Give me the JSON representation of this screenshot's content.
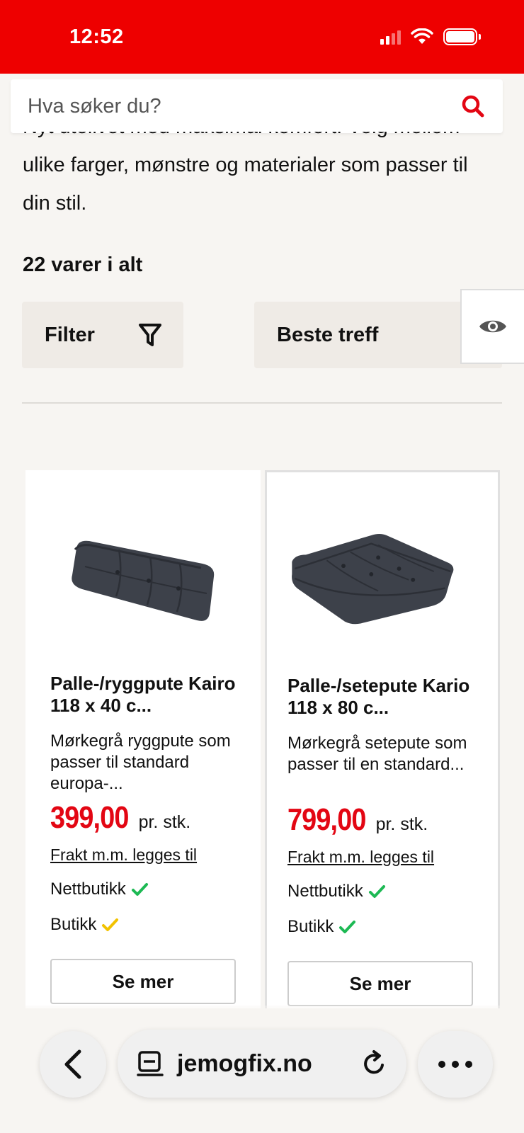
{
  "status_bar": {
    "time": "12:52"
  },
  "search": {
    "placeholder": "Hva søker du?"
  },
  "category": {
    "description": "Nyt utelivet med maksimal komfort. Velg mellom ulike farger, mønstre og materialer som passer til din stil.",
    "count_label": "22 varer i alt"
  },
  "controls": {
    "filter_label": "Filter",
    "sort_label": "Beste treff"
  },
  "products": [
    {
      "title": "Palle-/ryggpute Kairo 118 x 40 c...",
      "subtitle": "Mørkegrå ryggpute som passer til standard europa-...",
      "price": "399,00",
      "unit": "pr. stk.",
      "shipping": "Frakt m.m. legges til",
      "online_label": "Nettbutikk",
      "online_status": "available",
      "store_label": "Butikk",
      "store_status": "limited",
      "button_label": "Se mer"
    },
    {
      "title": "Palle-/setepute Kario 118 x 80 c...",
      "subtitle": "Mørkegrå setepute som passer til en standard...",
      "price": "799,00",
      "unit": "pr. stk.",
      "shipping": "Frakt m.m. legges til",
      "online_label": "Nettbutikk",
      "online_status": "available",
      "store_label": "Butikk",
      "store_status": "available",
      "button_label": "Se mer"
    }
  ],
  "browser": {
    "url": "jemogfix.no"
  },
  "colors": {
    "brand_red": "#ee0000",
    "price_red": "#e30613",
    "check_green": "#1db954",
    "check_yellow": "#f2c200"
  }
}
